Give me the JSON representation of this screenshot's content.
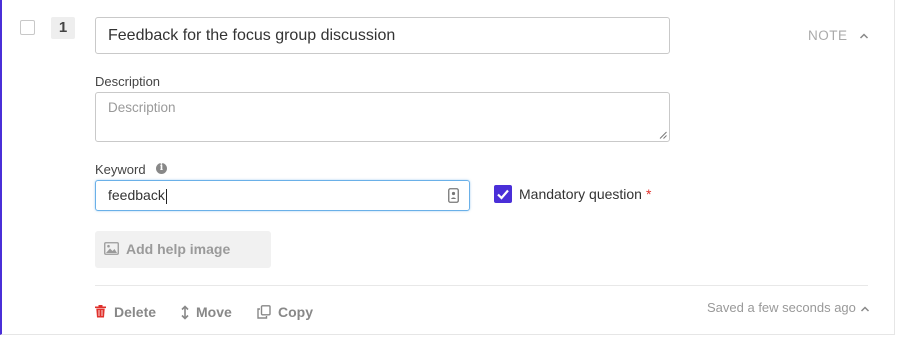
{
  "question": {
    "number": "1",
    "title": "Feedback for the focus group discussion",
    "type_label": "NOTE"
  },
  "description": {
    "label": "Description",
    "placeholder": "Description",
    "value": ""
  },
  "keyword": {
    "label": "Keyword",
    "value": "feedback"
  },
  "mandatory": {
    "label": "Mandatory question",
    "required_mark": "*",
    "checked": true
  },
  "help_image": {
    "label": "Add help image"
  },
  "footer": {
    "delete_label": "Delete",
    "move_label": "Move",
    "copy_label": "Copy",
    "saved_text": "Saved a few seconds ago"
  },
  "colors": {
    "accent": "#4a2fd8",
    "danger": "#e0312c",
    "focus_border": "#6ab0e8"
  },
  "icons": [
    "info-icon",
    "contact-card-icon",
    "checkmark-icon",
    "image-icon",
    "trash-icon",
    "vertical-arrows-icon",
    "copy-icon",
    "chevron-up-icon"
  ]
}
